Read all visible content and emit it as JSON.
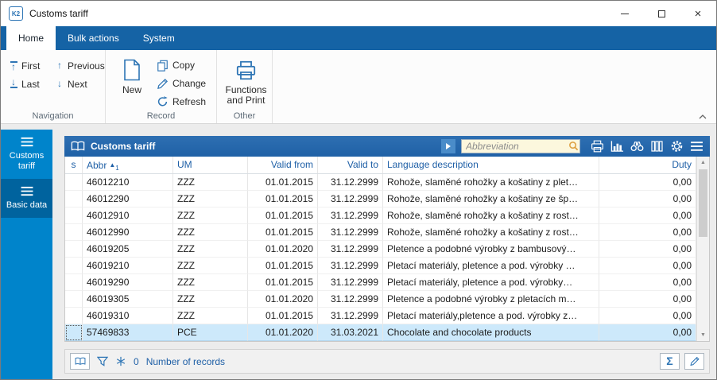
{
  "window": {
    "title": "Customs tariff"
  },
  "ribbon": {
    "tabs": [
      {
        "label": "Home",
        "active": true
      },
      {
        "label": "Bulk actions",
        "active": false
      },
      {
        "label": "System",
        "active": false
      }
    ],
    "groups": {
      "navigation": {
        "label": "Navigation",
        "items": [
          {
            "label": "First",
            "icon": "first-icon"
          },
          {
            "label": "Previous",
            "icon": "previous-icon"
          },
          {
            "label": "Last",
            "icon": "last-icon"
          },
          {
            "label": "Next",
            "icon": "next-icon"
          }
        ]
      },
      "record": {
        "label": "Record",
        "primary": {
          "label": "New",
          "icon": "new-document-icon"
        },
        "items": [
          {
            "label": "Copy",
            "icon": "copy-icon"
          },
          {
            "label": "Change",
            "icon": "change-icon"
          },
          {
            "label": "Refresh",
            "icon": "refresh-icon"
          }
        ]
      },
      "other": {
        "label": "Other",
        "primary": {
          "label": "Functions and Print",
          "icon": "printer-icon"
        }
      }
    }
  },
  "sidebar": {
    "items": [
      {
        "label": "Customs tariff",
        "icon": "list-icon",
        "active": true
      },
      {
        "label": "Basic data",
        "icon": "list-icon",
        "active": false
      }
    ]
  },
  "panel": {
    "title": "Customs tariff",
    "title_icon": "book-icon",
    "play_icon": "play-icon",
    "search": {
      "placeholder": "Abbreviation",
      "icon": "magnifier-icon"
    },
    "toolbar_icons": [
      "printer-icon",
      "chart-icon",
      "binoculars-icon",
      "columns-icon",
      "gear-icon",
      "menu-icon"
    ]
  },
  "table": {
    "columns": [
      {
        "label": "s",
        "align": "center"
      },
      {
        "label": "Abbr",
        "align": "left"
      },
      {
        "label": "UM",
        "align": "left"
      },
      {
        "label": "Valid from",
        "align": "right"
      },
      {
        "label": "Valid to",
        "align": "right"
      },
      {
        "label": "Language description",
        "align": "left"
      },
      {
        "label": "Duty",
        "align": "right"
      }
    ],
    "sort": {
      "column": "Abbr",
      "direction": "asc",
      "indicator": "▲",
      "order": "1"
    },
    "rows": [
      {
        "cells": [
          "",
          "46012210",
          "ZZZ",
          "01.01.2015",
          "31.12.2999",
          "Rohože, slaměné rohožky a košatiny z plet…",
          "0,00"
        ],
        "selected": false
      },
      {
        "cells": [
          "",
          "46012290",
          "ZZZ",
          "01.01.2015",
          "31.12.2999",
          "Rohože, slaměné rohožky a košatiny ze šp…",
          "0,00"
        ],
        "selected": false
      },
      {
        "cells": [
          "",
          "46012910",
          "ZZZ",
          "01.01.2015",
          "31.12.2999",
          "Rohože, slaměné rohožky a košatiny z rost…",
          "0,00"
        ],
        "selected": false
      },
      {
        "cells": [
          "",
          "46012990",
          "ZZZ",
          "01.01.2015",
          "31.12.2999",
          "Rohože, slaměné rohožky a košatiny z rost…",
          "0,00"
        ],
        "selected": false
      },
      {
        "cells": [
          "",
          "46019205",
          "ZZZ",
          "01.01.2020",
          "31.12.2999",
          "Pletence a podobné výrobky z bambusový…",
          "0,00"
        ],
        "selected": false
      },
      {
        "cells": [
          "",
          "46019210",
          "ZZZ",
          "01.01.2015",
          "31.12.2999",
          "Pletací materiály, pletence a pod. výrobky …",
          "0,00"
        ],
        "selected": false
      },
      {
        "cells": [
          "",
          "46019290",
          "ZZZ",
          "01.01.2015",
          "31.12.2999",
          "Pletací materiály, pletence a pod. výrobky…",
          "0,00"
        ],
        "selected": false
      },
      {
        "cells": [
          "",
          "46019305",
          "ZZZ",
          "01.01.2020",
          "31.12.2999",
          "Pletence a podobné výrobky z pletacích m…",
          "0,00"
        ],
        "selected": false
      },
      {
        "cells": [
          "",
          "46019310",
          "ZZZ",
          "01.01.2015",
          "31.12.2999",
          "Pletací materiály,pletence a pod. výrobky z…",
          "0,00"
        ],
        "selected": false
      },
      {
        "cells": [
          "",
          "57469833",
          "PCE",
          "01.01.2020",
          "31.03.2021",
          "Chocolate and chocolate products",
          "0,00"
        ],
        "selected": true
      }
    ]
  },
  "statusbar": {
    "count": "0",
    "records_label": "Number of records",
    "left_icons": [
      "book-icon",
      "filter-icon",
      "snowflake-icon"
    ],
    "right_icons": [
      "sum-icon",
      "pencil-icon"
    ]
  },
  "colors": {
    "accent": "#1563a5",
    "sidebar": "#0084cb",
    "panel_header": "#2265aa",
    "selected_row": "#cde9fb",
    "header_text": "#1e5fa6"
  }
}
